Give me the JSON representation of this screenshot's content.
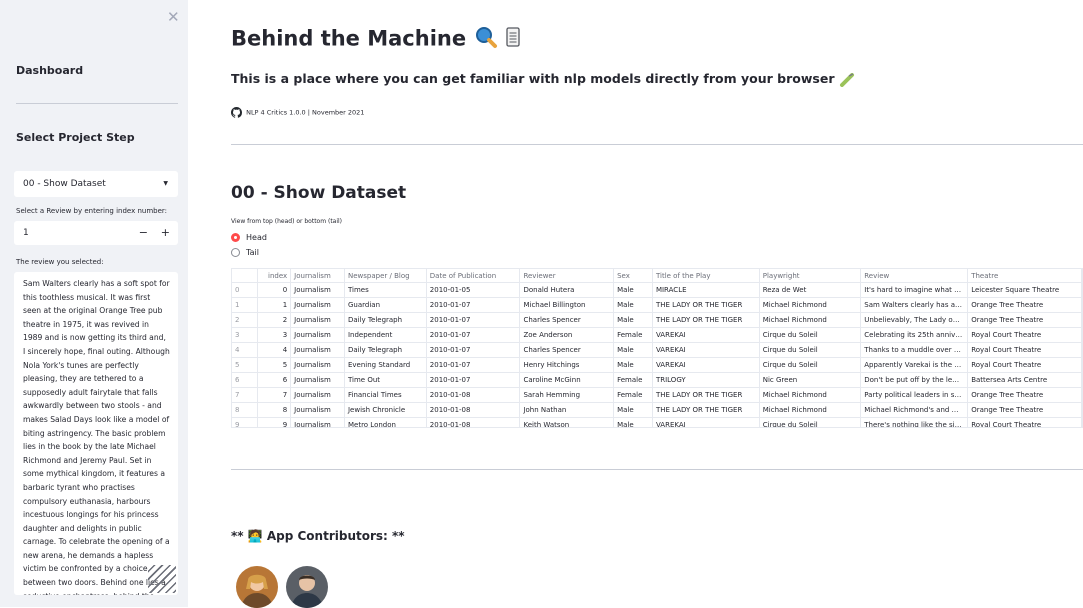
{
  "sidebar": {
    "close_glyph": "✕",
    "dashboard": "Dashboard",
    "select_step_label": "Select Project Step",
    "step_value": "00 - Show Dataset",
    "index_label": "Select a Review by entering index number:",
    "index_value": "1",
    "minus": "−",
    "plus": "+",
    "review_label": "The review you selected:",
    "review_text": "Sam Walters clearly has a soft spot for this toothless musical. It was first seen at the original Orange Tree pub theatre in 1975, it was revived in 1989 and is now getting its third and, I sincerely hope, final outing. Although Nola York's tunes are perfectly pleasing, they are tethered to a supposedly adult fairytale that falls awkwardly between two stools - and makes Salad Days look like a model of biting astringency. The basic problem lies in the book by the late Michael Richmond and Jeremy Paul. Set in some mythical kingdom, it features a barbaric tyrant who practises compulsory euthanasia, harbours incestuous longings for his princess daughter and delights in public carnage. To celebrate the opening of a new arena, he demands a hapless victim be confronted by a choice between two doors. Behind one lies a seductive enchantress, behind the other a tiger. Since the princess's new"
  },
  "header": {
    "title": "Behind the Machine",
    "subtitle": "This is a place where you can get familiar with nlp models directly from your browser",
    "meta": "NLP 4 Critics 1.0.0 | November 2021"
  },
  "section": {
    "title": "00 - Show Dataset",
    "view_label": "View from top (head) or bottom (tail)",
    "radio_head": "Head",
    "radio_tail": "Tail"
  },
  "table": {
    "columns": [
      "",
      "index",
      "Journalism",
      "Newspaper / Blog",
      "Date of Publication",
      "Reviewer",
      "Sex",
      "Title of the Play",
      "Playwright",
      "Review",
      "Theatre"
    ],
    "rows": [
      [
        "0",
        "0",
        "Journalism",
        "Times",
        "2010-01-05",
        "Donald Hutera",
        "Male",
        "MIRACLE",
        "Reza de Wet",
        "It's hard to imagine what …",
        "Leicester Square Theatre"
      ],
      [
        "1",
        "1",
        "Journalism",
        "Guardian",
        "2010-01-07",
        "Michael Billington",
        "Male",
        "THE LADY OR THE TIGER",
        "Michael Richmond",
        "Sam Walters clearly has a…",
        "Orange Tree Theatre"
      ],
      [
        "2",
        "2",
        "Journalism",
        "Daily Telegraph",
        "2010-01-07",
        "Charles Spencer",
        "Male",
        "THE LADY OR THE TIGER",
        "Michael Richmond",
        "Unbelievably, The Lady o…",
        "Orange Tree Theatre"
      ],
      [
        "3",
        "3",
        "Journalism",
        "Independent",
        "2010-01-07",
        "Zoe Anderson",
        "Female",
        "VAREKAI",
        "Cirque du Soleil",
        "Celebrating its 25th anniv…",
        "Royal Court Theatre"
      ],
      [
        "4",
        "4",
        "Journalism",
        "Daily Telegraph",
        "2010-01-07",
        "Charles Spencer",
        "Male",
        "VAREKAI",
        "Cirque du Soleil",
        "Thanks to a muddle over …",
        "Royal Court Theatre"
      ],
      [
        "5",
        "5",
        "Journalism",
        "Evening Standard",
        "2010-01-07",
        "Henry Hitchings",
        "Male",
        "VAREKAI",
        "Cirque du Soleil",
        "Apparently Varekai is the …",
        "Royal Court Theatre"
      ],
      [
        "6",
        "6",
        "Journalism",
        "Time Out",
        "2010-01-07",
        "Caroline McGinn",
        "Female",
        "TRILOGY",
        "Nic Green",
        "Don't be put off by the le…",
        "Battersea Arts Centre"
      ],
      [
        "7",
        "7",
        "Journalism",
        "Financial Times",
        "2010-01-08",
        "Sarah Hemming",
        "Female",
        "THE LADY OR THE TIGER",
        "Michael Richmond",
        "Party political leaders in s…",
        "Orange Tree Theatre"
      ],
      [
        "8",
        "8",
        "Journalism",
        "Jewish Chronicle",
        "2010-01-08",
        "John Nathan",
        "Male",
        "THE LADY OR THE TIGER",
        "Michael Richmond",
        "Michael Richmond's and …",
        "Orange Tree Theatre"
      ],
      [
        "9",
        "9",
        "Journalism",
        "Metro London",
        "2010-01-08",
        "Keith Watson",
        "Male",
        "VAREKAI",
        "Cirque du Soleil",
        "There's nothing like the si…",
        "Royal Court Theatre"
      ]
    ]
  },
  "contributors": {
    "heading": "** 🧑‍💻 App Contributors: **"
  },
  "colors": {
    "accent": "#ff4b4b",
    "sidebar_bg": "#f0f2f6",
    "text": "#262730"
  },
  "icons": [
    "magnifier-icon",
    "notepad-icon",
    "test-tube-icon",
    "github-icon",
    "close-icon",
    "chevron-down-icon",
    "resize-handle-icon"
  ]
}
